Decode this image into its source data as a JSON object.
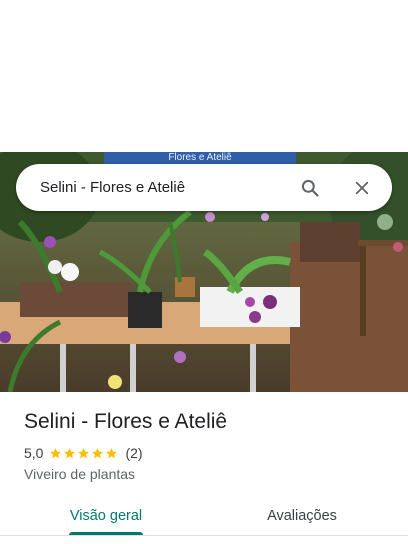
{
  "search": {
    "query": "Selini - Flores e Ateliê",
    "search_icon": "search-icon",
    "close_icon": "close-icon"
  },
  "photo": {
    "sign_text": "Flores e Ateliê"
  },
  "place": {
    "title": "Selini - Flores e Ateliê",
    "rating": "5,0",
    "stars": 5,
    "review_count": "(2)",
    "category": "Viveiro de plantas"
  },
  "tabs": [
    {
      "label": "Visão geral",
      "active": true
    },
    {
      "label": "Avaliações",
      "active": false
    }
  ],
  "colors": {
    "accent": "#01796f",
    "star": "#fbbc04"
  }
}
